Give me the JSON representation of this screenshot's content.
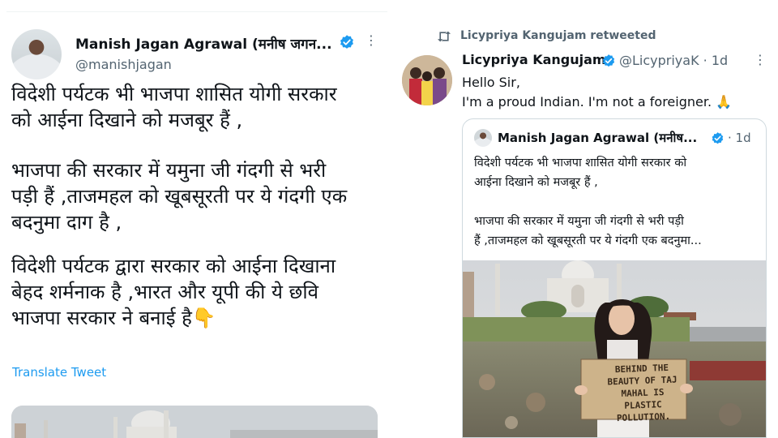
{
  "left_tweet": {
    "author_name": "Manish Jagan Agrawal (मनीष जगन...",
    "author_handle": "@manishjagan",
    "more": "⋮",
    "paragraphs": [
      "विदेशी पर्यटक भी भाजपा शासित योगी सरकार\nको आईना दिखाने को मजबूर हैं ,",
      "भाजपा की सरकार में यमुना जी गंदगी से भरी\nपड़ी हैं ,ताजमहल को खूबसूरती पर ये गंदगी एक\nबदनुमा दाग है ,",
      "विदेशी पर्यटक द्वारा सरकार को आईना दिखाना\nबेहद शर्मनाक है ,भारत और यूपी की ये छवि\nभाजपा सरकार ने बनाई है👇"
    ],
    "translate_label": "Translate Tweet",
    "media_icon": "taj-mahal-photo"
  },
  "right_tweet": {
    "retweet_label": "Licypriya Kangujam retweeted",
    "author_name": "Licypriya Kangujam",
    "author_handle": "@LicypriyaK · 1d",
    "more": "⋮",
    "lines": [
      "Hello Sir,",
      "I'm a proud Indian. I'm not a foreigner. 🙏"
    ],
    "quoted": {
      "author_name": "Manish Jagan Agrawal (मनीष...",
      "time": "· 1d",
      "paragraphs": [
        "विदेशी पर्यटक भी भाजपा शासित योगी सरकार को\nआईना दिखाने को मजबूर हैं ,",
        "भाजपा की सरकार में यमुना जी गंदगी से भरी पड़ी\nहैं ,ताजमहल को खूबसूरती पर ये गंदगी एक बदनुमा..."
      ],
      "photo_sign": "BEHIND THE BEAUTY OF TAJ MAHAL IS PLASTIC POLLUTION."
    }
  },
  "colors": {
    "link": "#1d9bf0",
    "verified": "#1d9bf0",
    "muted": "#536471",
    "text": "#0f1419",
    "border": "#cfd9de"
  }
}
